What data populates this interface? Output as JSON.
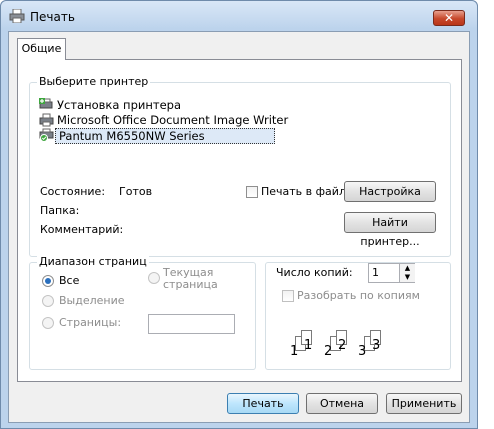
{
  "window": {
    "title": "Печать",
    "close_label": "✕"
  },
  "tabs": [
    {
      "label": "Общие"
    }
  ],
  "printer_group": {
    "legend": "Выберите принтер",
    "printers": [
      {
        "name": "Установка принтера",
        "icon": "add-printer-icon",
        "selected": false
      },
      {
        "name": "Microsoft Office Document Image Writer",
        "icon": "printer-icon",
        "selected": false
      },
      {
        "name": "Pantum M6550NW Series",
        "icon": "default-printer-icon",
        "selected": true
      }
    ],
    "status_label": "Состояние:",
    "status_value": "Готов",
    "folder_label": "Папка:",
    "comment_label": "Комментарий:",
    "print_to_file_label": "Печать в файл",
    "print_to_file_checked": false,
    "preferences_button": "Настройка",
    "find_printer_button": "Найти принтер..."
  },
  "page_range": {
    "legend": "Диапазон страниц",
    "options": [
      {
        "label": "Все",
        "selected": true,
        "enabled": true
      },
      {
        "label": "Выделение",
        "selected": false,
        "enabled": false
      },
      {
        "label": "Текущая страница",
        "selected": false,
        "enabled": false
      },
      {
        "label": "Страницы:",
        "selected": false,
        "enabled": true
      }
    ],
    "pages_value": ""
  },
  "copies": {
    "label": "Число копий:",
    "value": "1",
    "collate_label": "Разобрать по копиям",
    "collate_checked": false,
    "collate_numbers": [
      "1",
      "1",
      "2",
      "2",
      "3",
      "3"
    ]
  },
  "buttons": {
    "print": "Печать",
    "cancel": "Отмена",
    "apply": "Применить"
  }
}
